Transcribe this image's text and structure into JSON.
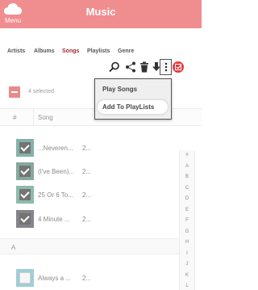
{
  "header": {
    "menu_label": "Menu",
    "title": "Music"
  },
  "tabs": [
    {
      "label": "Artists",
      "active": false
    },
    {
      "label": "Albums",
      "active": false
    },
    {
      "label": "Songs",
      "active": true
    },
    {
      "label": "Playlists",
      "active": false
    },
    {
      "label": "Genre",
      "active": false
    }
  ],
  "toolbar": {
    "icons": [
      "search-icon",
      "share-icon",
      "delete-icon",
      "download-icon",
      "more-vertical-icon",
      "check-circle-icon"
    ]
  },
  "selection": {
    "text": "4 selected"
  },
  "columns": {
    "number": "#",
    "song": "Song"
  },
  "rows": [
    {
      "title": "...Neveren...",
      "num": "2...",
      "checked": true
    },
    {
      "title": "(I've Been)...",
      "num": "2...",
      "checked": true
    },
    {
      "title": "25 Or 6 To...",
      "num": "2...",
      "checked": true
    },
    {
      "title": "4 Minute ...",
      "num": "2...",
      "checked": true
    },
    {
      "title": "Always a ...",
      "num": "2...",
      "checked": false
    }
  ],
  "section_header": "A",
  "alphabet": [
    "#",
    "A",
    "B",
    "C",
    "D",
    "E",
    "F",
    "G",
    "H",
    "I",
    "J",
    "K",
    "L"
  ],
  "popup": {
    "item1": "Play Songs",
    "item2": "Add To PlayLists"
  },
  "colors": {
    "accent": "#e53b3f",
    "active_tab": "#a32b2e"
  }
}
